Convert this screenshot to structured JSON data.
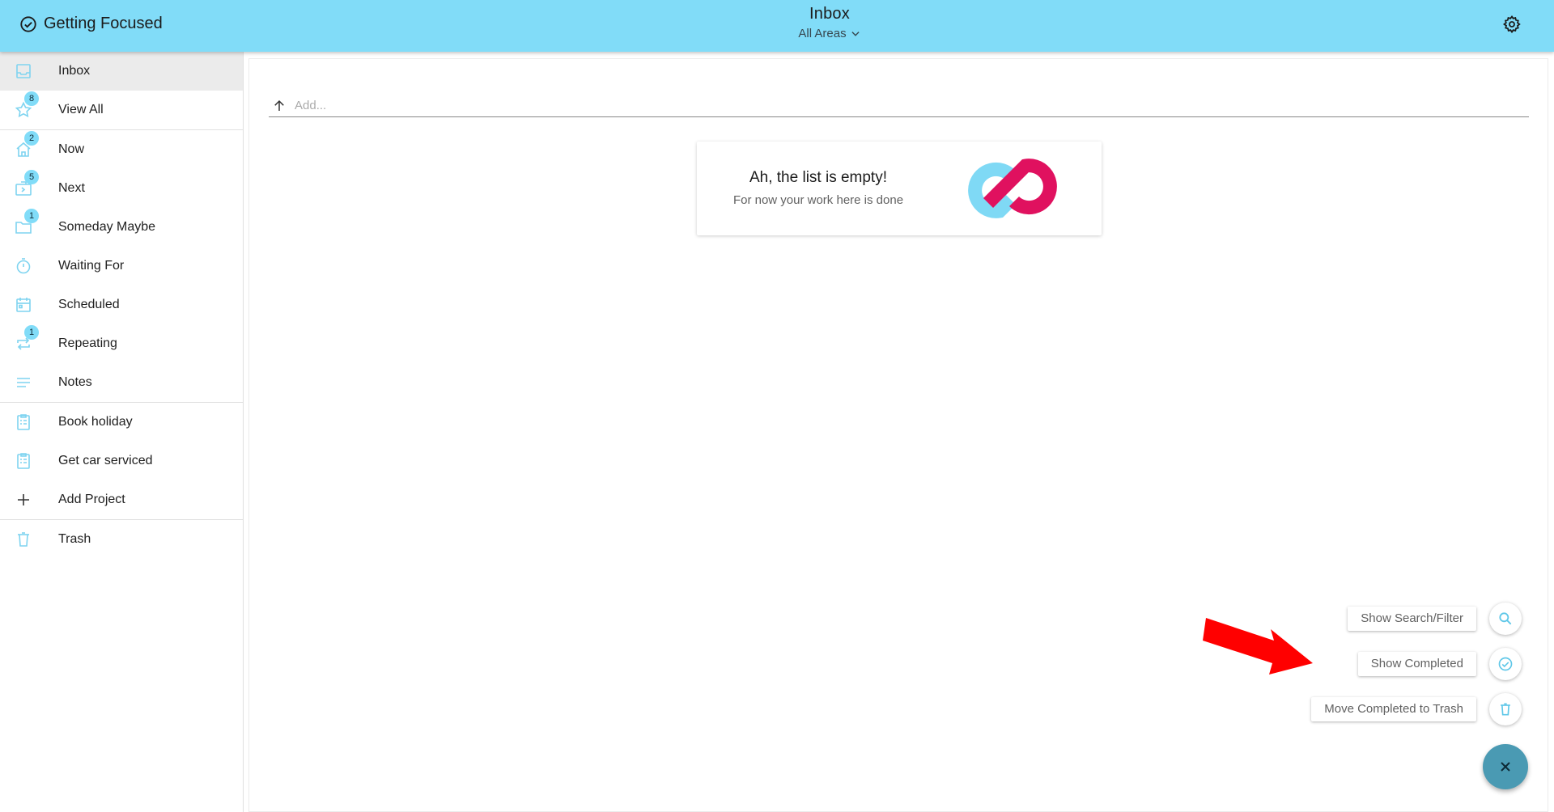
{
  "app": {
    "brand": "Getting Focused",
    "title": "Inbox",
    "area_selector": "All Areas"
  },
  "sidebar": {
    "items": [
      {
        "label": "Inbox",
        "icon": "inbox-icon",
        "badge": null,
        "active": true
      },
      {
        "label": "View All",
        "icon": "star-icon",
        "badge": "8"
      },
      {
        "label": "Now",
        "icon": "home-icon",
        "badge": "2"
      },
      {
        "label": "Next",
        "icon": "next-icon",
        "badge": "5"
      },
      {
        "label": "Someday Maybe",
        "icon": "folder-icon",
        "badge": "1"
      },
      {
        "label": "Waiting For",
        "icon": "timer-icon",
        "badge": null
      },
      {
        "label": "Scheduled",
        "icon": "calendar-icon",
        "badge": null
      },
      {
        "label": "Repeating",
        "icon": "repeat-icon",
        "badge": "1"
      },
      {
        "label": "Notes",
        "icon": "notes-icon",
        "badge": null
      },
      {
        "label": "Book holiday",
        "icon": "clipboard-icon",
        "badge": null
      },
      {
        "label": "Get car serviced",
        "icon": "clipboard-icon",
        "badge": null
      },
      {
        "label": "Add Project",
        "icon": "plus-icon",
        "badge": null
      },
      {
        "label": "Trash",
        "icon": "trash-icon",
        "badge": null
      }
    ]
  },
  "main": {
    "add_placeholder": "Add...",
    "empty_heading": "Ah, the list is empty!",
    "empty_sub": "For now your work here is done"
  },
  "speed_dial": {
    "search": "Show Search/Filter",
    "completed": "Show Completed",
    "trash": "Move Completed to Trash"
  },
  "colors": {
    "appbar": "#81dcf8",
    "accent": "#7fd4f0",
    "fab": "#4a9ab3",
    "logo_blue": "#7fd9f5",
    "logo_pink": "#e0115f",
    "annotation_arrow": "#ff0000"
  }
}
